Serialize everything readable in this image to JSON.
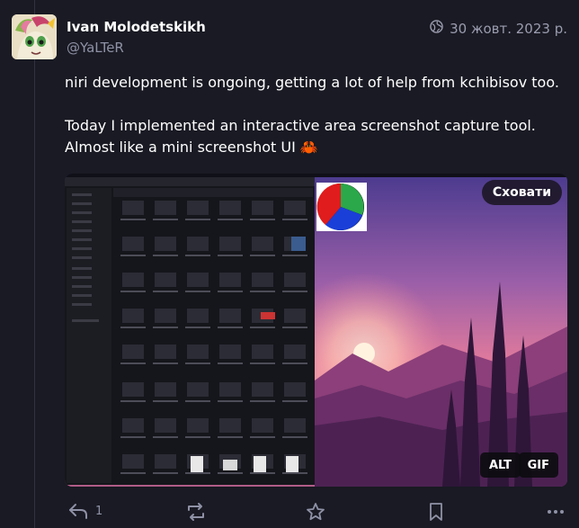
{
  "author": {
    "display_name": "Ivan Molodetskikh",
    "handle": "@YaLTeR"
  },
  "post": {
    "visibility_icon": "globe-icon",
    "timestamp": "30 жовт. 2023 р.",
    "paragraphs": [
      "niri development is ongoing, getting a lot of help from kchibisov too.",
      "Today I implemented an interactive area screenshot capture tool. Almost like a mini screenshot UI"
    ],
    "emoji": "🦀"
  },
  "media": {
    "hide_label": "Сховати",
    "alt_label": "ALT",
    "gif_label": "GIF"
  },
  "actions": {
    "reply_count": "1"
  },
  "colors": {
    "background": "#191a23",
    "muted_text": "#8f91a6",
    "sunset_sky": "#c76ca0"
  }
}
